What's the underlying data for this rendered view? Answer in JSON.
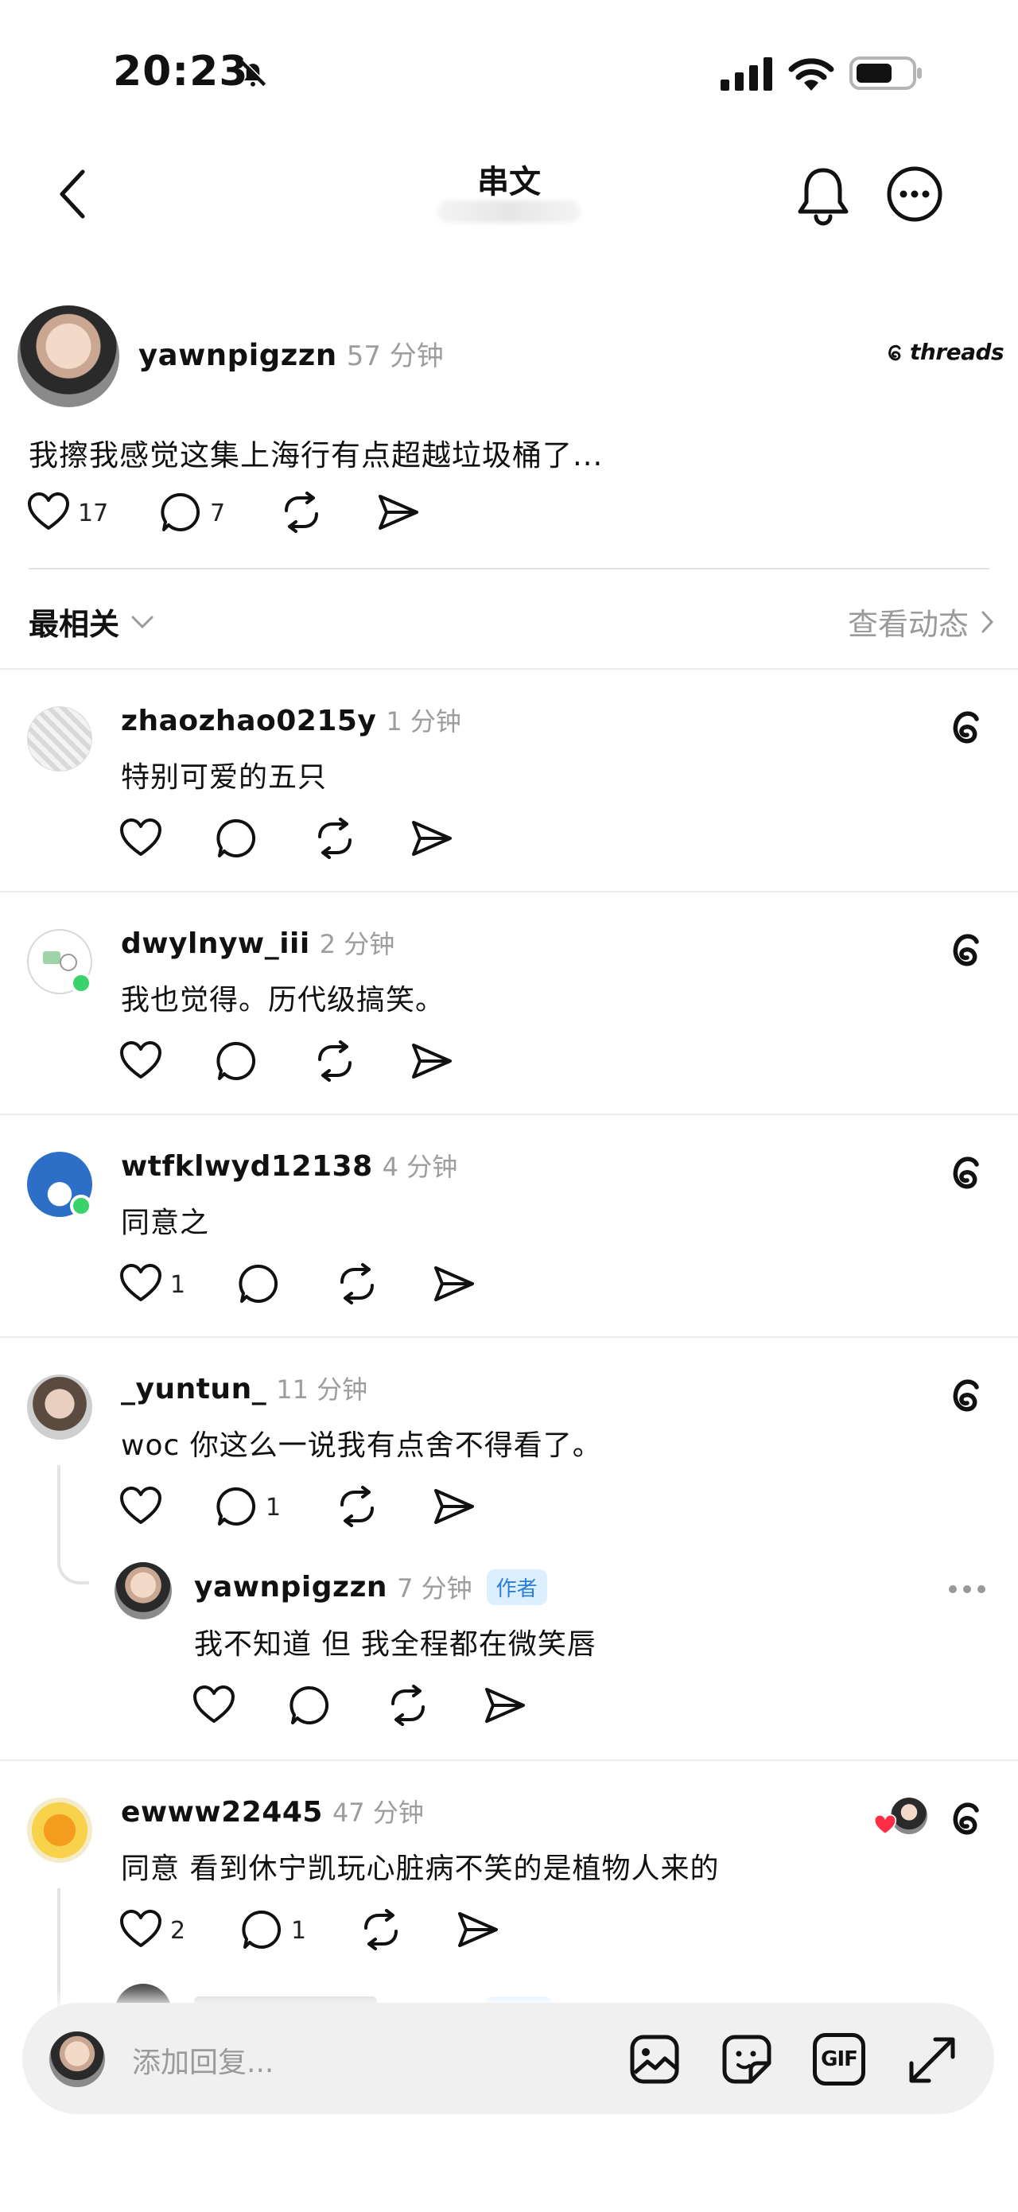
{
  "status_bar": {
    "time": "20:23"
  },
  "header": {
    "title": "串文"
  },
  "post": {
    "username": "yawnpigzzn",
    "time": "57 分钟",
    "source_label": "threads",
    "text": "我擦我感觉这集上海行有点超越垃圾桶了...",
    "likes": "17",
    "replies": "7"
  },
  "sort_bar": {
    "sort_label": "最相关",
    "activity_label": "查看动态"
  },
  "comments": [
    {
      "username": "zhaozhao0215y",
      "time": "1 分钟",
      "text": "特别可爱的五只",
      "likes": "",
      "replies": ""
    },
    {
      "username": "dwylnyw_iii",
      "time": "2 分钟",
      "text": "我也觉得。历代级搞笑。",
      "likes": "",
      "replies": ""
    },
    {
      "username": "wtfklwyd12138",
      "time": "4 分钟",
      "text": "同意之",
      "likes": "1",
      "replies": ""
    },
    {
      "username": "_yuntun_",
      "time": "11 分钟",
      "text": "woc 你这么一说我有点舍不得看了。",
      "likes": "",
      "replies": "1"
    },
    {
      "username": "ewww22445",
      "time": "47 分钟",
      "text": "同意 看到休宁凯玩心脏病不笑的是植物人来的",
      "likes": "2",
      "replies": "1"
    }
  ],
  "nested_reply": {
    "username": "yawnpigzzn",
    "time": "7 分钟",
    "badge": "作者",
    "text": "我不知道 但 我全程都在微笑唇"
  },
  "composer": {
    "placeholder": "添加回复...",
    "gif_label": "GIF"
  }
}
